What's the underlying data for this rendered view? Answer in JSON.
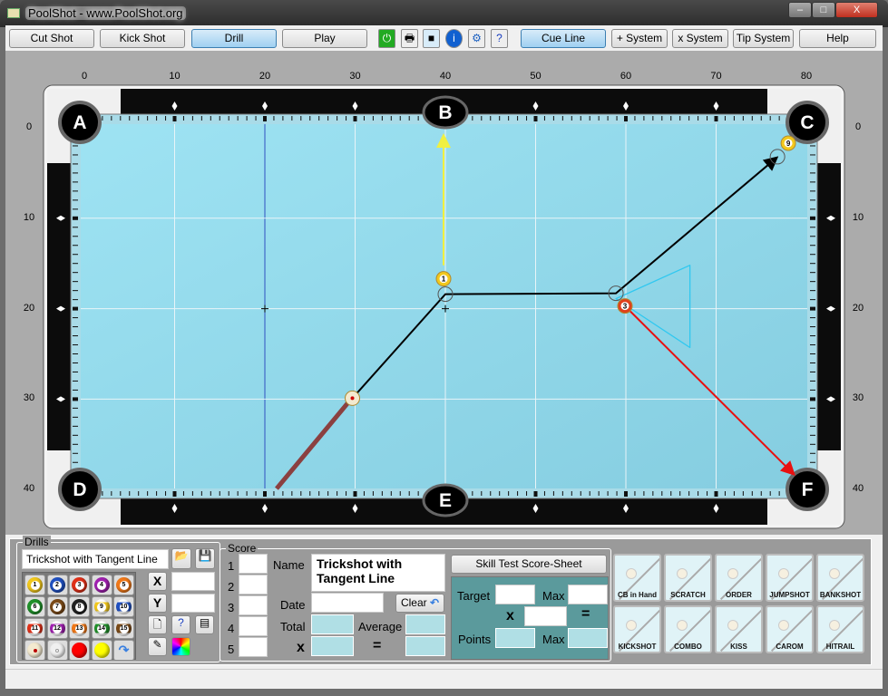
{
  "window": {
    "title": "PoolShot - www.PoolShot.org",
    "min": "–",
    "max": "□",
    "close": "X"
  },
  "toolbar": {
    "buttons": [
      {
        "label": "Cut Shot",
        "active": false
      },
      {
        "label": "Kick Shot",
        "active": false
      },
      {
        "label": "Drill",
        "active": true
      },
      {
        "label": "Play",
        "active": false
      }
    ],
    "icons": [
      "power-icon",
      "printer-icon",
      "camera-icon",
      "info-icon",
      "gear-icon",
      "help-document-icon"
    ],
    "right_buttons": [
      {
        "label": "Cue Line",
        "active": true
      },
      {
        "label": "+ System",
        "active": false
      },
      {
        "label": "x System",
        "active": false
      },
      {
        "label": "Tip System",
        "active": false
      },
      {
        "label": "Help",
        "active": false
      }
    ]
  },
  "table": {
    "x_ticks": [
      "0",
      "10",
      "20",
      "30",
      "40",
      "50",
      "60",
      "70",
      "80"
    ],
    "y_ticks": [
      "0",
      "10",
      "20",
      "30",
      "40"
    ],
    "pockets": [
      {
        "label": "A",
        "x": 0,
        "y": 0
      },
      {
        "label": "B",
        "x": 40,
        "y": 0
      },
      {
        "label": "C",
        "x": 80,
        "y": 0
      },
      {
        "label": "D",
        "x": 0,
        "y": 40
      },
      {
        "label": "E",
        "x": 40,
        "y": 40
      },
      {
        "label": "F",
        "x": 80,
        "y": 40
      }
    ],
    "balls": [
      {
        "id": "cue",
        "label": "",
        "x": 29.7,
        "y": 29.9,
        "color": "#f3ead0"
      },
      {
        "id": "1",
        "label": "1",
        "x": 39.8,
        "y": 16.7,
        "color": "#f2c81c"
      },
      {
        "id": "3",
        "label": "3",
        "x": 59.9,
        "y": 19.7,
        "color": "#e0401c"
      },
      {
        "id": "9",
        "label": "9",
        "x": 78,
        "y": 1.7,
        "color": "#f2c81c"
      }
    ],
    "ghost_balls": [
      {
        "x": 40,
        "y": 18.4
      },
      {
        "x": 58.9,
        "y": 18.3
      },
      {
        "x": 76.8,
        "y": 3.2
      }
    ],
    "cue_stick": {
      "from": [
        21.3,
        39.9
      ],
      "to": [
        29.3,
        30.3
      ],
      "color": "#8b4040"
    },
    "lines": [
      {
        "points": [
          [
            29.7,
            29.9
          ],
          [
            40,
            18.4
          ],
          [
            58.9,
            18.3
          ],
          [
            76.6,
            3.4
          ]
        ],
        "color": "#000000",
        "arrow": true
      },
      {
        "points": [
          [
            39.8,
            15.2
          ],
          [
            39.8,
            1
          ]
        ],
        "color": "#f0f040",
        "arrow": true
      },
      {
        "points": [
          [
            59.9,
            19.7
          ],
          [
            78.5,
            38.2
          ]
        ],
        "color": "#e81010",
        "arrow": true
      }
    ],
    "triangle": {
      "points": [
        [
          58.9,
          18.9
        ],
        [
          67.1,
          15.2
        ],
        [
          67.1,
          24.3
        ]
      ],
      "color": "#30c8f0"
    },
    "crosshairs": [
      {
        "x": 20,
        "y": 20
      },
      {
        "x": 40,
        "y": 20
      }
    ],
    "colors": {
      "cloth": "#92d9ea",
      "rail": "#0c0c0c",
      "cushion": "#a9dbe8"
    }
  },
  "drills": {
    "title": "Drills",
    "name_value": "Trickshot with Tangent Line",
    "balls": [
      {
        "n": "1",
        "c": "#f2c81c"
      },
      {
        "n": "2",
        "c": "#2050c0"
      },
      {
        "n": "3",
        "c": "#e03018"
      },
      {
        "n": "4",
        "c": "#a020b0"
      },
      {
        "n": "5",
        "c": "#f07818"
      },
      {
        "n": "6",
        "c": "#20902a"
      },
      {
        "n": "7",
        "c": "#7a4a18"
      },
      {
        "n": "8",
        "c": "#222222"
      },
      {
        "n": "9",
        "c": "#f2c81c"
      },
      {
        "n": "10",
        "c": "#2050c0"
      },
      {
        "n": "11",
        "c": "#e03018"
      },
      {
        "n": "12",
        "c": "#a020b0"
      },
      {
        "n": "13",
        "c": "#f07818"
      },
      {
        "n": "14",
        "c": "#20902a"
      },
      {
        "n": "15",
        "c": "#7a4a18"
      }
    ],
    "x_label": "X",
    "y_label": "Y"
  },
  "score": {
    "title": "Score",
    "rows": [
      "1",
      "2",
      "3",
      "4",
      "5"
    ],
    "name_label": "Name",
    "name_value": "Trickshot with Tangent Line",
    "date_label": "Date",
    "clear_label": "Clear",
    "total_label": "Total",
    "average_label": "Average",
    "x_label": "x",
    "eq_label": "="
  },
  "skill": {
    "button": "Skill Test Score-Sheet",
    "target_label": "Target",
    "max_label": "Max",
    "x_label": "x",
    "eq_label": "=",
    "points_label": "Points",
    "max2_label": "Max",
    "bg": "#5b9a9c"
  },
  "shot_types": [
    "CB in Hand",
    "SCRATCH",
    "ORDER",
    "JUMPSHOT",
    "BANKSHOT",
    "KICKSHOT",
    "COMBO",
    "KISS",
    "CAROM",
    "HITRAIL"
  ]
}
